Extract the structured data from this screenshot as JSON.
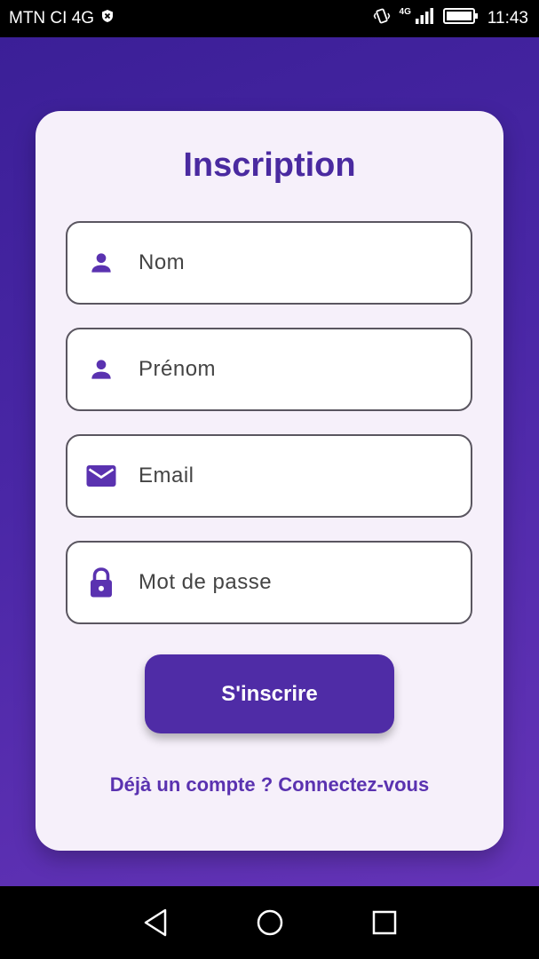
{
  "status_bar": {
    "carrier": "MTN CI 4G",
    "net_small": "4G",
    "time": "11:43"
  },
  "form": {
    "title": "Inscription",
    "fields": [
      {
        "placeholder": "Nom",
        "icon": "person-icon"
      },
      {
        "placeholder": "Prénom",
        "icon": "person-icon"
      },
      {
        "placeholder": "Email",
        "icon": "email-icon"
      },
      {
        "placeholder": "Mot de passe",
        "icon": "lock-icon"
      }
    ],
    "submit_label": "S'inscrire",
    "login_link": "Déjà un compte ? Connectez-vous"
  },
  "colors": {
    "accent": "#4f2ca6",
    "icon": "#5a32b0",
    "card_bg": "#f6f0fa"
  }
}
